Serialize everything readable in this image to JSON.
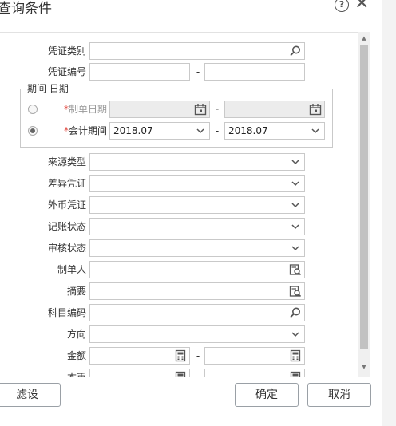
{
  "title": "查询条件",
  "fields": {
    "voucher_type": "凭证类别",
    "voucher_no": "凭证编号",
    "source_type": "来源类型",
    "diff_voucher": "差异凭证",
    "fx_voucher": "外币凭证",
    "posting_status": "记账状态",
    "audit_status": "审核状态",
    "maker": "制单人",
    "summary": "摘要",
    "account_code": "科目编码",
    "direction": "方向",
    "amount": "金额",
    "original_currency": "本币"
  },
  "period": {
    "legend": "期间 日期",
    "make_date_label": "制单日期",
    "acct_period_label": "会计期间",
    "required_mark": "*",
    "period_from": "2018.07",
    "period_to": "2018.07"
  },
  "range_dash": "-",
  "buttons": {
    "filter": "滤设",
    "ok": "确定",
    "cancel": "取消"
  },
  "icons": {
    "help": "?",
    "close": "✕",
    "scroll_up": "▲",
    "scroll_down": "▼"
  }
}
